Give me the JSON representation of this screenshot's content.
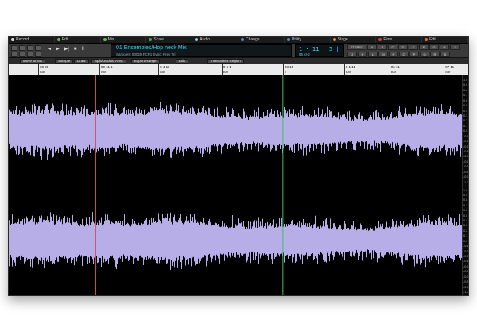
{
  "tabs": [
    {
      "label": "Record",
      "color": "#d9d9d9"
    },
    {
      "label": "Edit",
      "color": "#58c050"
    },
    {
      "label": "Mix",
      "color": "#58c050"
    },
    {
      "label": "Scale",
      "color": "#4fa04a"
    },
    {
      "label": "Audio",
      "color": "#9ad0ff"
    },
    {
      "label": "Change",
      "color": "#4a90d9"
    },
    {
      "label": "Utility",
      "color": "#4a90d9"
    },
    {
      "label": "Stage",
      "color": "#c8a040"
    },
    {
      "label": "Flow",
      "color": "#d04040"
    },
    {
      "label": "Edit",
      "color": "#e07020"
    }
  ],
  "toolbar": {
    "transport": [
      "◂",
      "▶",
      "▶|",
      "■",
      "II"
    ],
    "title": "01 Ensembles/Hop neck Mix",
    "subtitle": "Samples: 80028 FCP1   Sync: Prev Tri",
    "counter_time": "1 · 11 | 5 |",
    "counter_sub": "96 kHz",
    "right_tools": [
      "STEREO",
      "A",
      "B",
      "C",
      "D",
      "E",
      "F",
      "G",
      "H",
      "I",
      "J",
      "K",
      "L",
      "M",
      "N",
      "O",
      "P",
      "Q",
      "R",
      "S"
    ]
  },
  "row2": {
    "buttons": [
      "Move Break",
      "Sample",
      "Draw",
      "Split/Declaid Area",
      "Export Range",
      "Edit",
      "Inset Silent Region"
    ]
  },
  "ruler": {
    "marks": [
      {
        "label": "00 00",
        "sub": "Bar",
        "pos": 6.5
      },
      {
        "label": "00 11 1",
        "sub": "Bar",
        "pos": 20
      },
      {
        "label": "0 4 11",
        "sub": "Bar",
        "pos": 33
      },
      {
        "label": "0 5 1",
        "sub": "Bar",
        "pos": 47
      },
      {
        "label": "03 15",
        "sub": "0",
        "pos": 60.5
      },
      {
        "label": "0 1 11",
        "sub": "Bar",
        "pos": 74
      },
      {
        "label": "06 11",
        "sub": "Bar",
        "pos": 84
      },
      {
        "label": "07 11",
        "sub": "Bar",
        "pos": 96
      }
    ]
  },
  "scale": {
    "top_labels": [
      "1.0",
      "0.9",
      "0.8",
      "0.7",
      "0.6",
      "0.5",
      "0.4",
      "0.3",
      "0.2",
      "0.1",
      "0.0",
      "-0.1",
      "-0.2",
      "-0.3",
      "-0.4",
      "-0.5",
      "-0.6",
      "-0.7",
      "-0.8",
      "-0.9",
      "-1.0"
    ],
    "bottom_labels": [
      "1.0",
      "0.9",
      "0.8",
      "0.7",
      "0.6",
      "0.5",
      "0.4",
      "0.3",
      "0.2",
      "0.1",
      "0.0",
      "-0.1",
      "-0.2",
      "-0.3",
      "-0.4",
      "-0.5",
      "-0.6",
      "-0.7",
      "-0.8",
      "-0.9",
      "-1.0"
    ]
  },
  "waveform": {
    "color": "#b7aee8",
    "marker_red": "#d0506a",
    "marker_green": "#3cc06a"
  }
}
